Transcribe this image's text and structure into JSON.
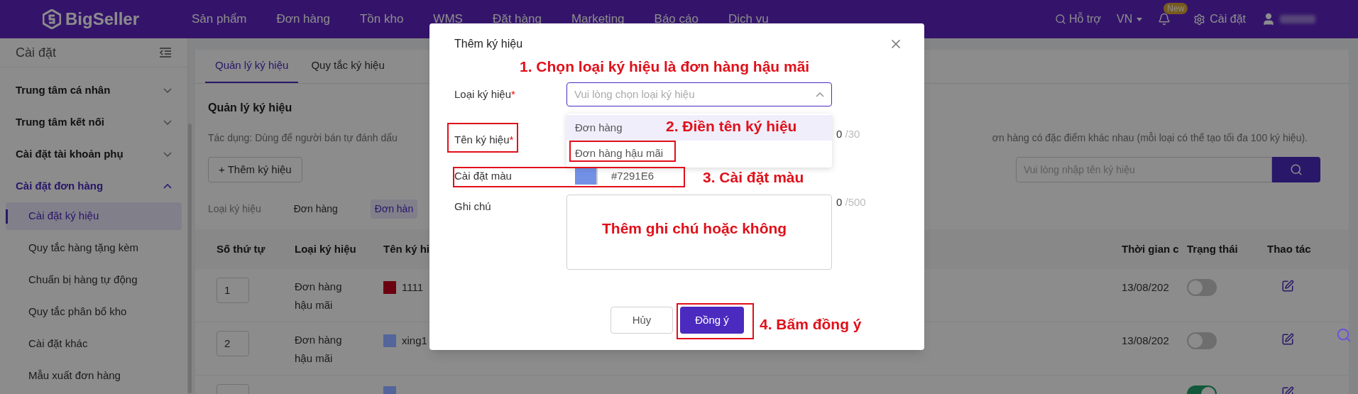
{
  "nav": {
    "logo": "BigSeller",
    "items": [
      "Sản phẩm",
      "Đơn hàng",
      "Tồn kho",
      "WMS",
      "Đặt hàng",
      "Marketing",
      "Báo cáo",
      "Dịch vụ"
    ],
    "help": "Hỗ trợ",
    "lang": "VN",
    "badge": "New",
    "settings": "Cài đặt"
  },
  "sidebar": {
    "title": "Cài đặt",
    "groups": [
      {
        "label": "Trung tâm cá nhân",
        "expanded": false
      },
      {
        "label": "Trung tâm kết nối",
        "expanded": false
      },
      {
        "label": "Cài đặt tài khoản phụ",
        "expanded": false
      },
      {
        "label": "Cài đặt đơn hàng",
        "expanded": true,
        "children": [
          {
            "label": "Cài đặt ký hiệu",
            "selected": true
          },
          {
            "label": "Quy tắc hàng tặng kèm",
            "selected": false
          },
          {
            "label": "Chuẩn bị hàng tự động",
            "selected": false
          },
          {
            "label": "Quy tắc phân bổ kho",
            "selected": false
          },
          {
            "label": "Cài đặt khác",
            "selected": false
          },
          {
            "label": "Mẫu xuất đơn hàng",
            "selected": false
          }
        ]
      }
    ]
  },
  "tabs": [
    {
      "label": "Quản lý ký hiệu",
      "selected": true
    },
    {
      "label": "Quy tắc ký hiệu",
      "selected": false
    }
  ],
  "panel": {
    "title": "Quản lý ký hiệu",
    "description_left": "Tác dụng: Dùng để người bán tự đánh dấu",
    "description_right": "ơn hàng có đặc điểm khác nhau (mỗi loại có thể tạo tối đa 100 ký hiệu).",
    "add_button": "+ Thêm ký hiệu",
    "search_placeholder": "Vui lòng nhập tên ký hiệu"
  },
  "filter": {
    "label": "Loại ký hiệu",
    "options": [
      {
        "label": "Đơn hàng",
        "selected": false
      },
      {
        "label": "Đơn hàn",
        "selected": true
      }
    ]
  },
  "table": {
    "columns_left": [
      "Số thứ tự",
      "Loại ký hiệu",
      "Tên ký hi"
    ],
    "columns_right": [
      "Thời gian c",
      "Trạng thái",
      "Thao tác"
    ],
    "rows": [
      {
        "index": "1",
        "type": "Đơn hàng hậu mãi",
        "color": "#6b0010",
        "name": "1111",
        "time": "13/08/202",
        "on": false
      },
      {
        "index": "2",
        "type": "Đơn hàng hậu mãi",
        "color": "#53659a",
        "name": "xing1",
        "time": "13/08/202",
        "on": false
      },
      {
        "color": "#53659a",
        "on": true
      }
    ]
  },
  "modal": {
    "title": "Thêm ký hiệu",
    "type_field": {
      "label": "Loại ký hiệu",
      "required_mark": "*",
      "placeholder": "Vui lòng chọn loại ký hiệu",
      "expanded": true,
      "options": [
        {
          "label": "Đơn hàng",
          "selected": true
        },
        {
          "label": "Đơn hàng hậu mãi",
          "selected": false
        }
      ]
    },
    "name_field": {
      "label": "Tên ký hiệu",
      "required_mark": "*",
      "count": "0",
      "limit": "/30"
    },
    "color_field": {
      "label": "Cài đặt màu",
      "value": "#7291E6"
    },
    "note_field": {
      "label": "Ghi chú",
      "count": "0",
      "limit": "/500"
    },
    "cancel": "Hủy",
    "confirm": "Đồng ý"
  },
  "annotations": [
    "1. Chọn loại ký hiệu là đơn hàng hậu mãi",
    "2. Điền tên ký hiệu",
    "3. Cài đặt màu",
    "Thêm ghi chú hoặc không",
    "4. Bấm đồng ý"
  ]
}
